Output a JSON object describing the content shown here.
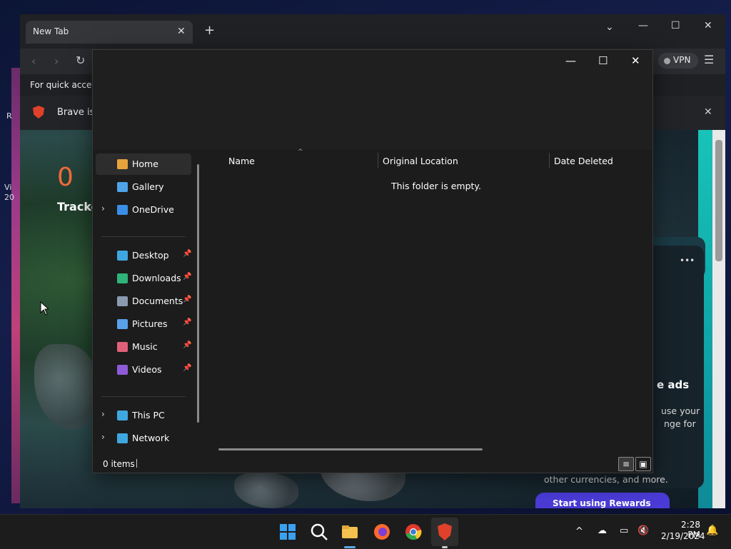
{
  "desktop": {
    "side_texts": [
      "R",
      "Vi",
      "20"
    ]
  },
  "browser": {
    "tab_title": "New Tab",
    "tab_close": "✕",
    "new_tab": "+",
    "controls": {
      "dropdown": "⌄",
      "minimize": "—",
      "maximize": "☐",
      "close": "✕"
    },
    "vpn_label": "VPN",
    "menu": "☰",
    "bookmarks_text": "For quick access,",
    "infobar_text": "Brave isn",
    "infobar_close": "✕",
    "tracker_count": "0",
    "tracker_label": "Tracke",
    "rewards": {
      "ellipsis": "•••",
      "headline": "e ads",
      "line1": "use your",
      "line2": "nge for",
      "line3": "other currencies, and more.",
      "button": "Start using Rewards"
    }
  },
  "explorer": {
    "controls": {
      "minimize": "—",
      "maximize": "☐",
      "close": "✕"
    },
    "nav": [
      {
        "label": "Home",
        "icon": "home-icon",
        "color": "#e8a33d",
        "selected": true
      },
      {
        "label": "Gallery",
        "icon": "gallery-icon",
        "color": "#4fa3e8"
      },
      {
        "label": "OneDrive",
        "icon": "cloud-icon",
        "color": "#3a8ee6",
        "chevron": true
      },
      {
        "label": "Desktop",
        "icon": "desktop-icon",
        "color": "#3fa7e0",
        "pinned": true
      },
      {
        "label": "Downloads",
        "icon": "download-icon",
        "color": "#2fb37a",
        "pinned": true
      },
      {
        "label": "Documents",
        "icon": "documents-icon",
        "color": "#8a9bb0",
        "pinned": true
      },
      {
        "label": "Pictures",
        "icon": "pictures-icon",
        "color": "#5aa0e8",
        "pinned": true
      },
      {
        "label": "Music",
        "icon": "music-icon",
        "color": "#e0607a",
        "pinned": true
      },
      {
        "label": "Videos",
        "icon": "videos-icon",
        "color": "#8e5ad8",
        "pinned": true
      },
      {
        "label": "This PC",
        "icon": "computer-icon",
        "color": "#3fa7e0",
        "chevron": true
      },
      {
        "label": "Network",
        "icon": "network-icon",
        "color": "#3fa7e0",
        "chevron": true
      }
    ],
    "columns": [
      "Name",
      "Original Location",
      "Date Deleted"
    ],
    "sort_indicator": "^",
    "empty_message": "This folder is empty.",
    "status": "0 items"
  },
  "taskbar": {
    "time": "2:28 PM",
    "date": "2/19/2024",
    "tray_chevron": "^"
  }
}
